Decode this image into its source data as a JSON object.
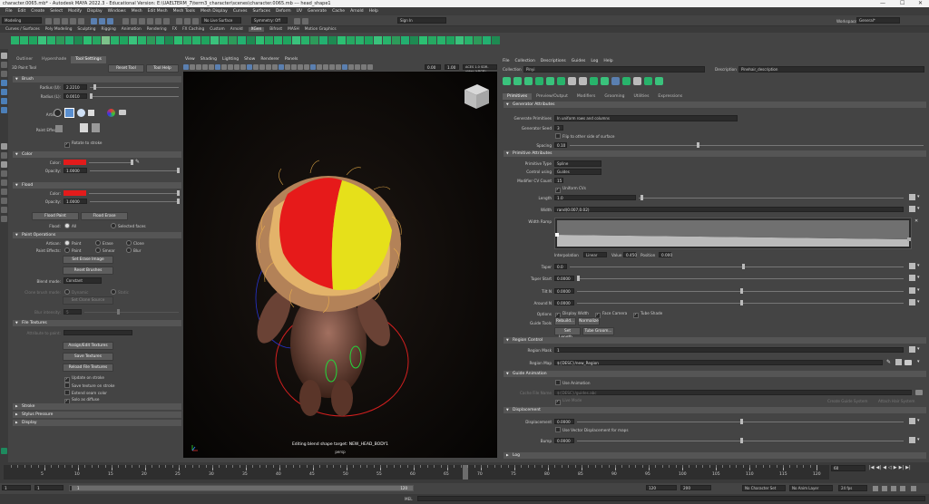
{
  "titlebar": {
    "text": "character.0065.mb* - Autodesk MAYA 2022.3 - Educational Version: E:\\UAELTERM_7\\term3_character\\scenes\\character.0065.mb  ---  head_shape1"
  },
  "menu": [
    "File",
    "Edit",
    "Create",
    "Select",
    "Modify",
    "Display",
    "Windows",
    "Mesh",
    "Edit Mesh",
    "Mesh Tools",
    "Mesh Display",
    "Curves",
    "Surfaces",
    "Deform",
    "UV",
    "Generate",
    "Cache",
    "Arnold",
    "Help"
  ],
  "status": {
    "mode": "Modeling",
    "no_live": "No Live Surface",
    "symmetry": "Symmetry: Off",
    "sign_in": "Sign In",
    "workspace_label": "Workspace:",
    "workspace_value": "General*"
  },
  "shelf_tabs": [
    "Curves / Surfaces",
    "Poly Modeling",
    "Sculpting",
    "Rigging",
    "Animation",
    "Rendering",
    "FX",
    "FX Caching",
    "Custom",
    "Arnold",
    "XGen",
    "Bifrost",
    "MASH",
    "Motion Graphics"
  ],
  "shelf_active": "XGen",
  "tool_settings": {
    "tabs": [
      "Outliner",
      "Hypershade",
      "Tool Settings"
    ],
    "tool_name": "3D Paint Tool",
    "reset_tool": "Reset Tool",
    "tool_help": "Tool Help",
    "brush": {
      "title": "Brush",
      "radius_u_label": "Radius (U):",
      "radius_u": "2.2210",
      "radius_l_label": "Radius (L):",
      "radius_l": "0.0010",
      "artisan_label": "Artisan:",
      "paint_effects_label": "Paint Effects:",
      "rotate_to_stroke": "Rotate to stroke"
    },
    "color": {
      "title": "Color",
      "color_label": "Color:",
      "color_value": "#e31b1b",
      "opacity_label": "Opacity:",
      "opacity": "1.0000"
    },
    "flood": {
      "title": "Flood",
      "color_label": "Color:",
      "color_value": "#e31b1b",
      "opacity_label": "Opacity:",
      "opacity": "1.0000",
      "flood_paint": "Flood Paint",
      "flood_erase": "Flood Erase",
      "flood_label": "Flood:",
      "all": "All",
      "selected_faces": "Selected faces"
    },
    "paint_operations": {
      "title": "Paint Operations",
      "artisan_label": "Artisan:",
      "paint_effects_label": "Paint Effects:",
      "paint": "Paint",
      "erase": "Erase",
      "clone": "Clone",
      "paint2": "Paint",
      "smear": "Smear",
      "blur": "Blur",
      "set_erase_image": "Set Erase Image",
      "reset_brushes": "Reset Brushes",
      "blend_mode_label": "Blend mode:",
      "blend_mode": "Constant",
      "clone_brush_mode_label": "Clone brush mode:",
      "dynamic": "Dynamic",
      "static": "Static",
      "set_clone_source": "Set Clone Source",
      "blur_intensity_label": "Blur intensity:",
      "blur_intensity": "5"
    },
    "file_textures": {
      "title": "File Textures",
      "attribute_to_paint_label": "Attribute to paint:",
      "assign_edit": "Assign/Edit Textures",
      "save_textures": "Save Textures",
      "reload": "Reload File Textures",
      "update_on_stroke": "Update on stroke",
      "save_on_stroke": "Save texture on stroke",
      "extend_seam": "Extend seam color",
      "solo_diffuse": "Solo as diffuse"
    },
    "collapsed": [
      "Stroke",
      "Stylus Pressure",
      "Display"
    ]
  },
  "viewport": {
    "menu": [
      "View",
      "Shading",
      "Lighting",
      "Show",
      "Renderer",
      "Panels"
    ],
    "field1": "0.00",
    "field2": "1.00",
    "colorspace": "ACES 1.0 SDR-video (sRGB)",
    "hud_text": "Editing blend shape target: NEW_HEAD_BODY1",
    "camera": "persp"
  },
  "attr_editor": {
    "menu": [
      "File",
      "Collection",
      "Descriptions",
      "Guides",
      "Log",
      "Help"
    ],
    "collection_label": "Collection",
    "collection_value": "Pinyi",
    "description_label": "Description",
    "description_value": "Pinehair_description",
    "tabs": [
      "Primitives",
      "Preview/Output",
      "Modifiers",
      "Grooming",
      "Utilities",
      "Expressions"
    ],
    "generator": {
      "title": "Generator Attributes",
      "generate_primitives_label": "Generate Primitives",
      "generate_primitives": "In uniform rows and columns",
      "generator_seed_label": "Generator Seed",
      "generator_seed": "3",
      "flip": "Flip to other side of surface",
      "spacing_label": "Spacing",
      "spacing": "0.10"
    },
    "primitive": {
      "title": "Primitive Attributes",
      "primitive_type_label": "Primitive Type",
      "primitive_type": "Spline",
      "control_using_label": "Control using",
      "control_using": "Guides",
      "modifier_cv_label": "Modifier CV Count",
      "modifier_cv": "15",
      "uniform_cvs": "Uniform CVs",
      "length_label": "Length",
      "length": "1.0",
      "width_label": "Width",
      "width": "rand(0.007,0.02)",
      "width_ramp_label": "Width Ramp",
      "interpolation_label": "Interpolation",
      "interpolation": "Linear",
      "value_label": "Value",
      "value": "0.450",
      "position_label": "Position",
      "position": "0.000",
      "taper_label": "Taper",
      "taper": "0.0",
      "taper_start_label": "Taper Start",
      "taper_start": "0.0000",
      "tilt_n_label": "Tilt N",
      "tilt_n": "0.0000",
      "around_n_label": "Around N",
      "around_n": "0.0000",
      "options_label": "Options",
      "display_width": "Display Width",
      "face_camera": "Face Camera",
      "tube_shade": "Tube Shade",
      "guide_tools_label": "Guide Tools",
      "rebuild": "Rebuild...",
      "normalize": "Normalize",
      "set_length": "Set Length...",
      "tube_groom": "Tube Groom..."
    },
    "region": {
      "title": "Region Control",
      "region_mask_label": "Region Mask",
      "region_mask": "1",
      "region_map_label": "Region Map",
      "region_map": "${DESC}/new_Region"
    },
    "guide_anim": {
      "title": "Guide Animation",
      "use_animation": "Use Animation",
      "cache_file_label": "Cache File Name",
      "cache_file": "${DESC}/guides.abc",
      "live_mode": "Live Mode",
      "create_guide": "Create Guide System",
      "attach_guide": "Attach Hair System"
    },
    "displacement": {
      "title": "Displacement",
      "displacement_label": "Displacement",
      "displacement": "0.0000",
      "use_vector": "Use Vector Displacement for maps",
      "bump_label": "Bump",
      "bump": "0.0000"
    },
    "log": "Log"
  },
  "timeline": {
    "ticks": [
      "5",
      "10",
      "15",
      "20",
      "25",
      "30",
      "35",
      "40",
      "45",
      "50",
      "55",
      "60",
      "65",
      "70",
      "75",
      "80",
      "85",
      "90",
      "95",
      "100",
      "105",
      "110",
      "115",
      "120"
    ],
    "current_frame": "60"
  },
  "range": {
    "start": "1",
    "inner_start": "1",
    "range_label": "1",
    "inner_end": "120",
    "end_a": "120",
    "end_b": "200",
    "char_set": "No Character Set",
    "anim_layer": "No Anim Layer",
    "fps": "24 fps"
  },
  "cmdline": {
    "label": "MEL"
  }
}
